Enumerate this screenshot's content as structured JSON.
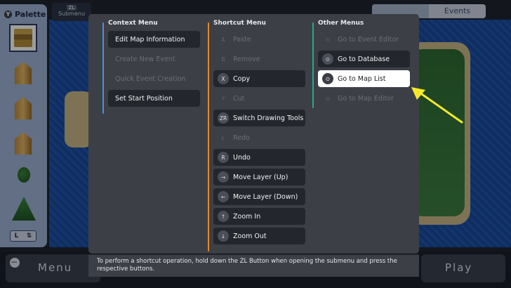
{
  "background": {
    "palette_title": "Palette",
    "palette_badge": "Y",
    "palette_footer_left": "L",
    "palette_footer_right": "⇅",
    "submenu_tab_key": "ZL",
    "submenu_tab_label": "Submenu",
    "top_tabs": [
      "",
      "Events"
    ],
    "menu_label": "Menu",
    "menu_key": "−",
    "play_label": "Play"
  },
  "dialog": {
    "columns": [
      {
        "title": "Context Menu",
        "accent": "#4a90e2",
        "items": [
          {
            "key": "",
            "label": "Edit Map Information",
            "state": "enabled"
          },
          {
            "key": "",
            "label": "Create New Event",
            "state": "disabled"
          },
          {
            "key": "",
            "label": "Quick Event Creation",
            "state": "disabled"
          },
          {
            "key": "",
            "label": "Set Start Position",
            "state": "enabled"
          }
        ]
      },
      {
        "title": "Shortcut Menu",
        "accent": "#e08a2a",
        "items": [
          {
            "key": "A",
            "label": "Paste",
            "state": "disabled"
          },
          {
            "key": "B",
            "label": "Remove",
            "state": "disabled"
          },
          {
            "key": "X",
            "label": "Copy",
            "state": "enabled"
          },
          {
            "key": "Y",
            "label": "Cut",
            "state": "disabled"
          },
          {
            "key": "ZR",
            "label": "Switch Drawing Tools",
            "state": "enabled"
          },
          {
            "key": "L",
            "label": "Redo",
            "state": "disabled"
          },
          {
            "key": "R",
            "label": "Undo",
            "state": "enabled"
          },
          {
            "key": "→",
            "label": "Move Layer (Up)",
            "state": "enabled"
          },
          {
            "key": "←",
            "label": "Move Layer (Down)",
            "state": "enabled"
          },
          {
            "key": "↑",
            "label": "Zoom In",
            "state": "enabled"
          },
          {
            "key": "↓",
            "label": "Zoom Out",
            "state": "enabled"
          }
        ]
      },
      {
        "title": "Other Menus",
        "accent": "#2aa88a",
        "items": [
          {
            "key": "⊙",
            "label": "Go to Event Editor",
            "state": "disabled"
          },
          {
            "key": "⊙",
            "label": "Go to Database",
            "state": "enabled"
          },
          {
            "key": "⊙",
            "label": "Go to Map List",
            "state": "selected"
          },
          {
            "key": "⊙",
            "label": "Go to Map Editor",
            "state": "disabled"
          }
        ]
      }
    ],
    "footer_text": "To perform a shortcut operation, hold down the ZL Button when opening the submenu and press the respective buttons."
  },
  "annotation": {
    "arrow_color": "#f5e92a"
  }
}
